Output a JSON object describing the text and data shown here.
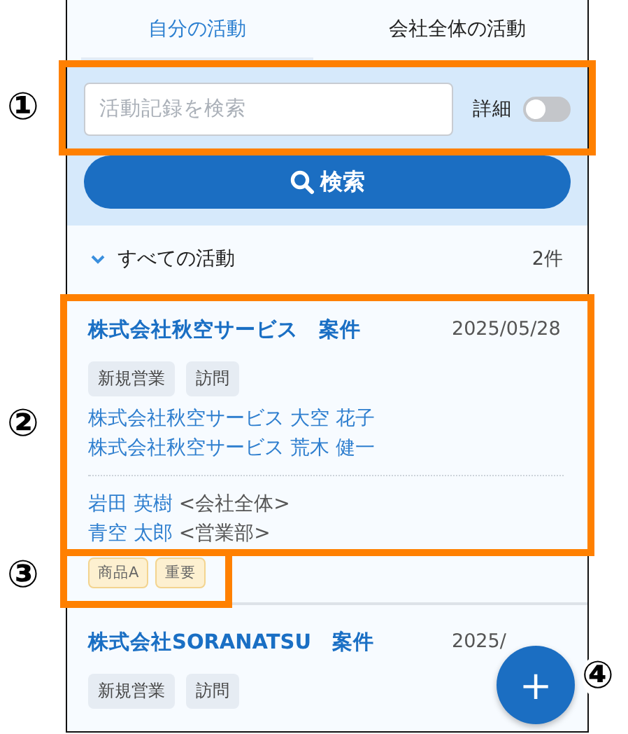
{
  "tabs": [
    {
      "label": "自分の活動",
      "selected": true
    },
    {
      "label": "会社全体の活動",
      "selected": false
    }
  ],
  "search": {
    "placeholder": "活動記録を検索",
    "detail_label": "詳細",
    "detail_on": false,
    "button": "検索"
  },
  "list_header": {
    "label": "すべての活動",
    "count": "2件",
    "expanded": true
  },
  "activities": [
    {
      "title": "株式会社秋空サービス　案件",
      "date": "2025/05/28",
      "tags": [
        "新規営業",
        "訪問"
      ],
      "contacts": [
        "株式会社秋空サービス 大空 花子",
        "株式会社秋空サービス 荒木 健一"
      ],
      "members": [
        {
          "name": "岩田 英樹",
          "group": "<会社全体>"
        },
        {
          "name": "青空 太郎",
          "group": "<営業部>"
        }
      ],
      "labels": [
        "商品A",
        "重要"
      ]
    },
    {
      "title": "株式会社SORANATSU　案件",
      "date": "2025/",
      "tags": [
        "新規営業",
        "訪問"
      ]
    }
  ],
  "fab": {
    "label": "＋"
  },
  "annotations": [
    {
      "label": "①"
    },
    {
      "label": "②"
    },
    {
      "label": "③"
    },
    {
      "label": "④"
    }
  ]
}
